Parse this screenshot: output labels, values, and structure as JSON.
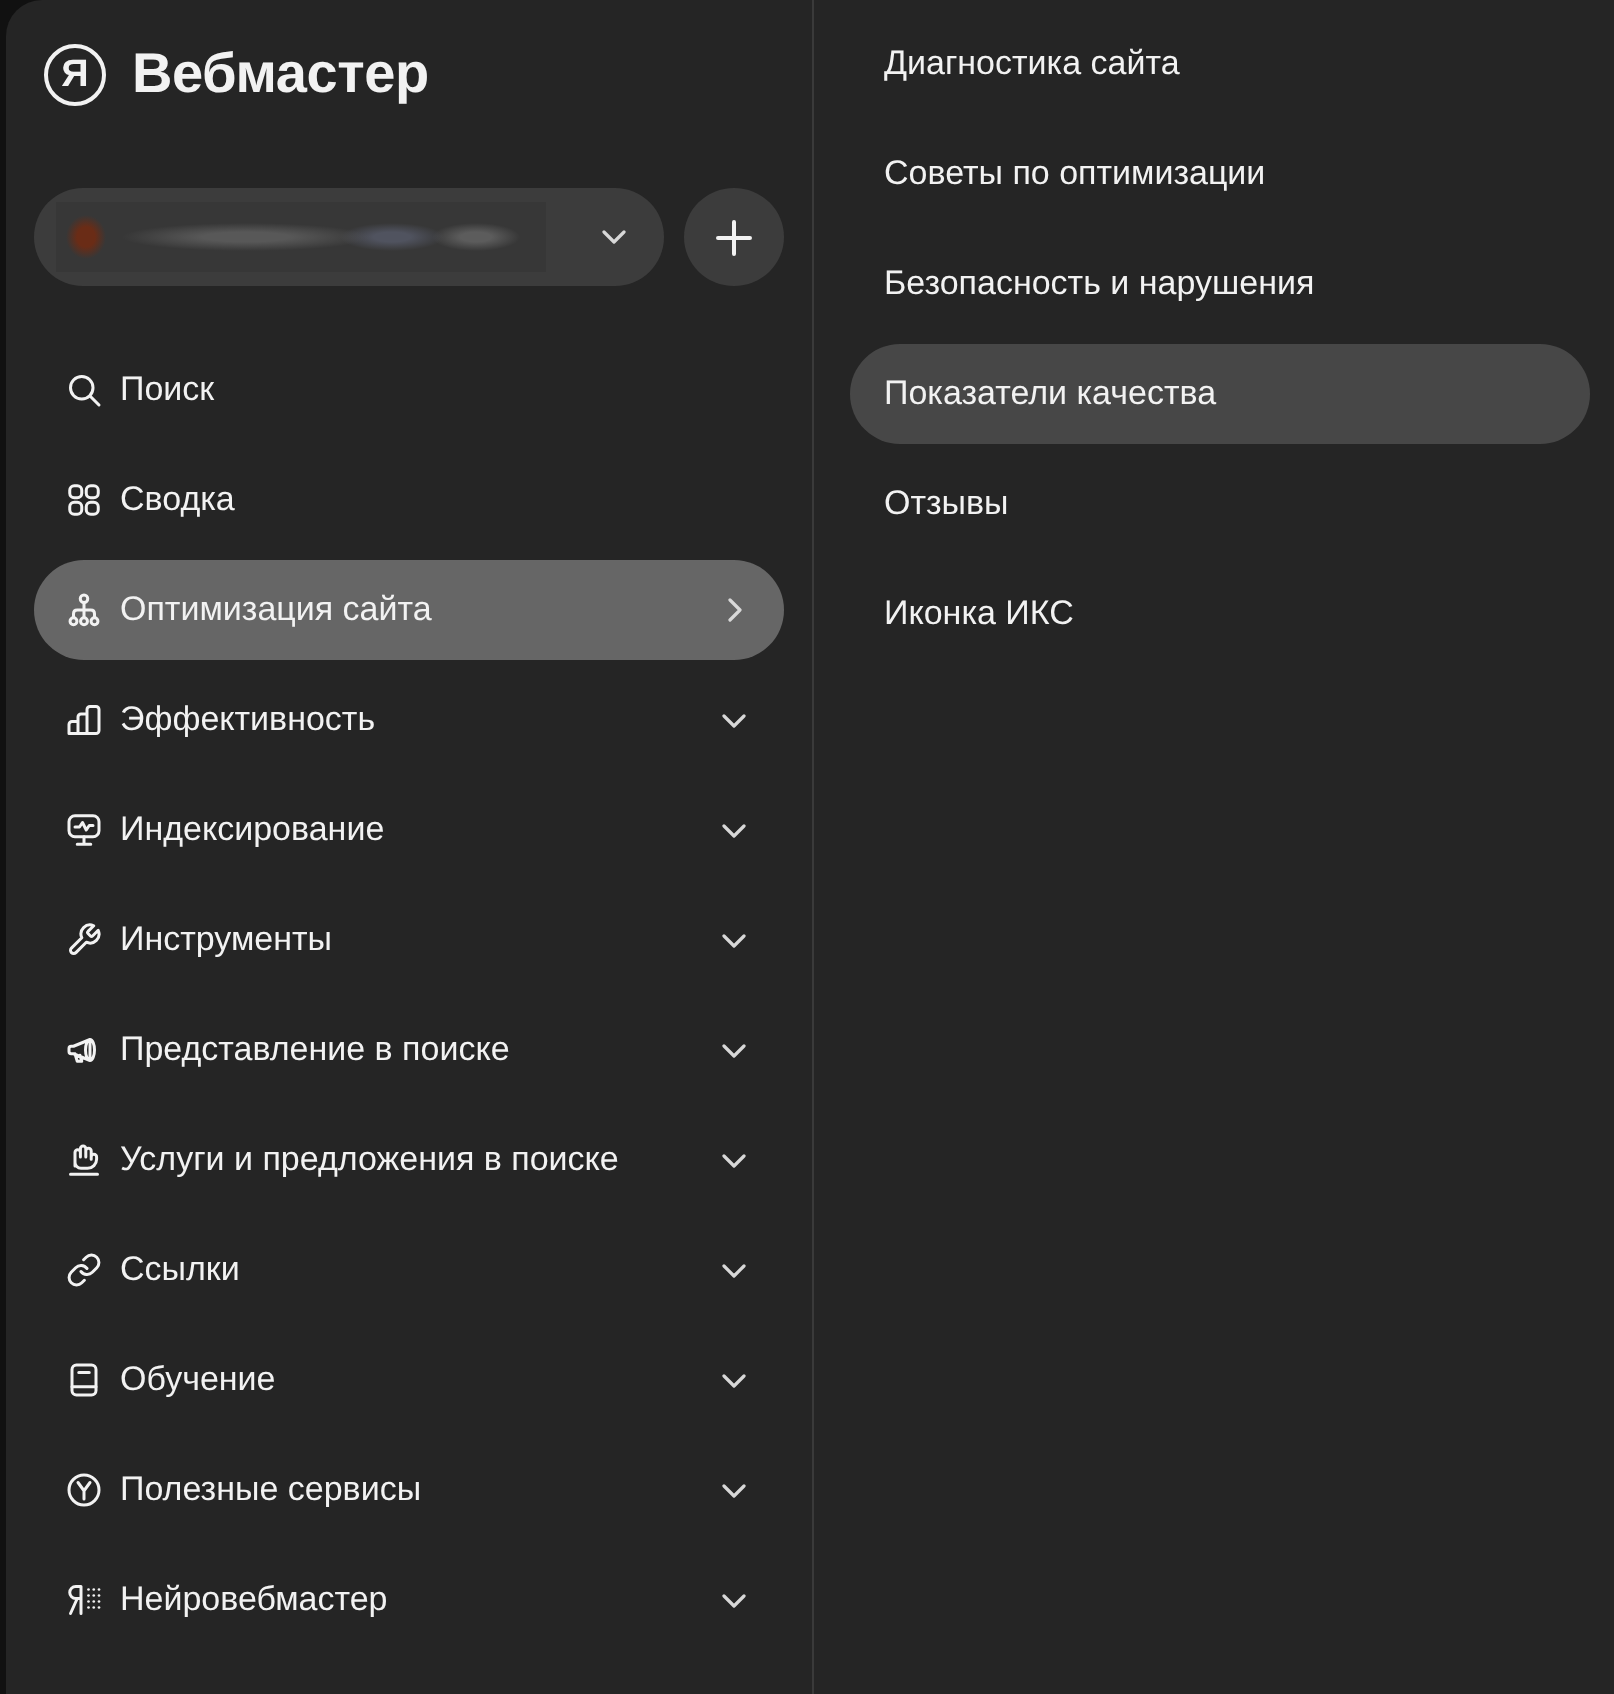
{
  "sidebar": {
    "logo": {
      "mark": "Я",
      "text": "Вебмастер"
    },
    "items": [
      {
        "label": "Поиск",
        "kind": "link",
        "selected": false
      },
      {
        "label": "Сводка",
        "kind": "link",
        "selected": false
      },
      {
        "label": "Оптимизация сайта",
        "kind": "flyout",
        "selected": true
      },
      {
        "label": "Эффективность",
        "kind": "group",
        "selected": false,
        "expanded": false
      },
      {
        "label": "Индексирование",
        "kind": "group",
        "selected": false,
        "expanded": false
      },
      {
        "label": "Инструменты",
        "kind": "group",
        "selected": false,
        "expanded": false
      },
      {
        "label": "Представление в поиске",
        "kind": "group",
        "selected": false,
        "expanded": false
      },
      {
        "label": "Услуги и предложения в поиске",
        "kind": "group",
        "selected": false,
        "expanded": false
      },
      {
        "label": "Ссылки",
        "kind": "group",
        "selected": false,
        "expanded": false
      },
      {
        "label": "Обучение",
        "kind": "group",
        "selected": false,
        "expanded": false
      },
      {
        "label": "Полезные сервисы",
        "kind": "group",
        "selected": false,
        "expanded": false
      },
      {
        "label": "Нейровебмастер",
        "kind": "group",
        "selected": false,
        "expanded": false
      }
    ]
  },
  "submenu": {
    "items": [
      {
        "label": "Диагностика сайта",
        "selected": false
      },
      {
        "label": "Советы по оптимизации",
        "selected": false
      },
      {
        "label": "Безопасность и нарушения",
        "selected": false
      },
      {
        "label": "Показатели качества",
        "selected": true
      },
      {
        "label": "Отзывы",
        "selected": false
      },
      {
        "label": "Иконка ИКС",
        "selected": false
      }
    ]
  }
}
